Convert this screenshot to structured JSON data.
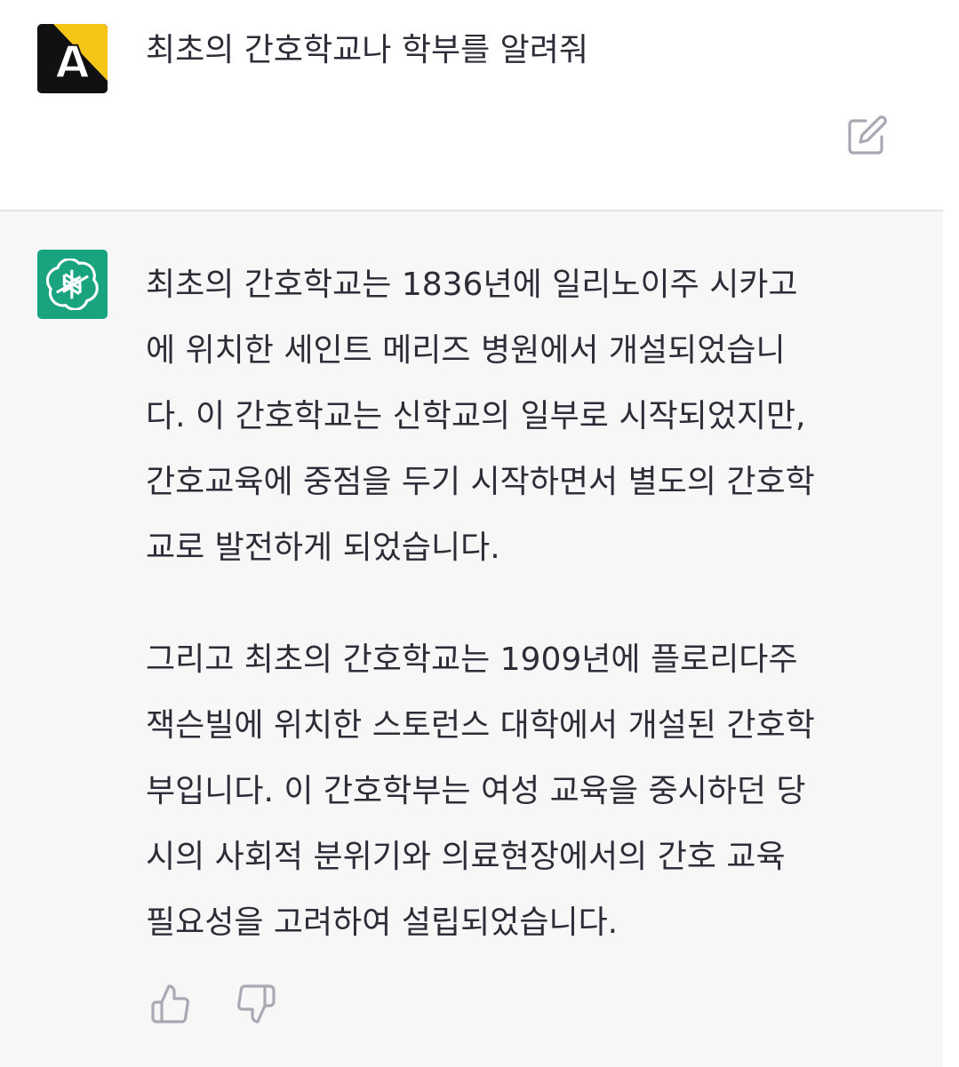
{
  "user": {
    "avatar_icon": "letter-a-avatar-icon",
    "avatar_letter": "A",
    "message": "최초의 간호학교나 학부를 알려줘",
    "edit_icon": "edit-icon"
  },
  "assistant": {
    "avatar_icon": "openai-logo-icon",
    "lines": [
      "최초의 간호학교는 1836년에 일리노이주 시카고",
      "에 위치한 세인트 메리즈 병원에서 개설되었습니",
      "다. 이 간호학교는 신학교의 일부로 시작되었지만,",
      "간호교육에 중점을 두기 시작하면서 별도의 간호학",
      "교로 발전하게 되었습니다.",
      "그리고 최초의 간호학교는 1909년에 플로리다주",
      "잭슨빌에 위치한 스토런스 대학에서 개설된 간호학",
      "부입니다. 이 간호학부는 여성 교육을 중시하던 당",
      "시의 사회적 분위기와 의료현장에서의 간호 교육",
      "필요성을 고려하여 설립되었습니다."
    ],
    "thumbs_up_icon": "thumbs-up-icon",
    "thumbs_down_icon": "thumbs-down-icon"
  },
  "colors": {
    "assistant_bg": "#f7f7f8",
    "assistant_avatar": "#19a37f",
    "user_avatar_accent": "#f5c518",
    "text": "#2d2d38"
  }
}
